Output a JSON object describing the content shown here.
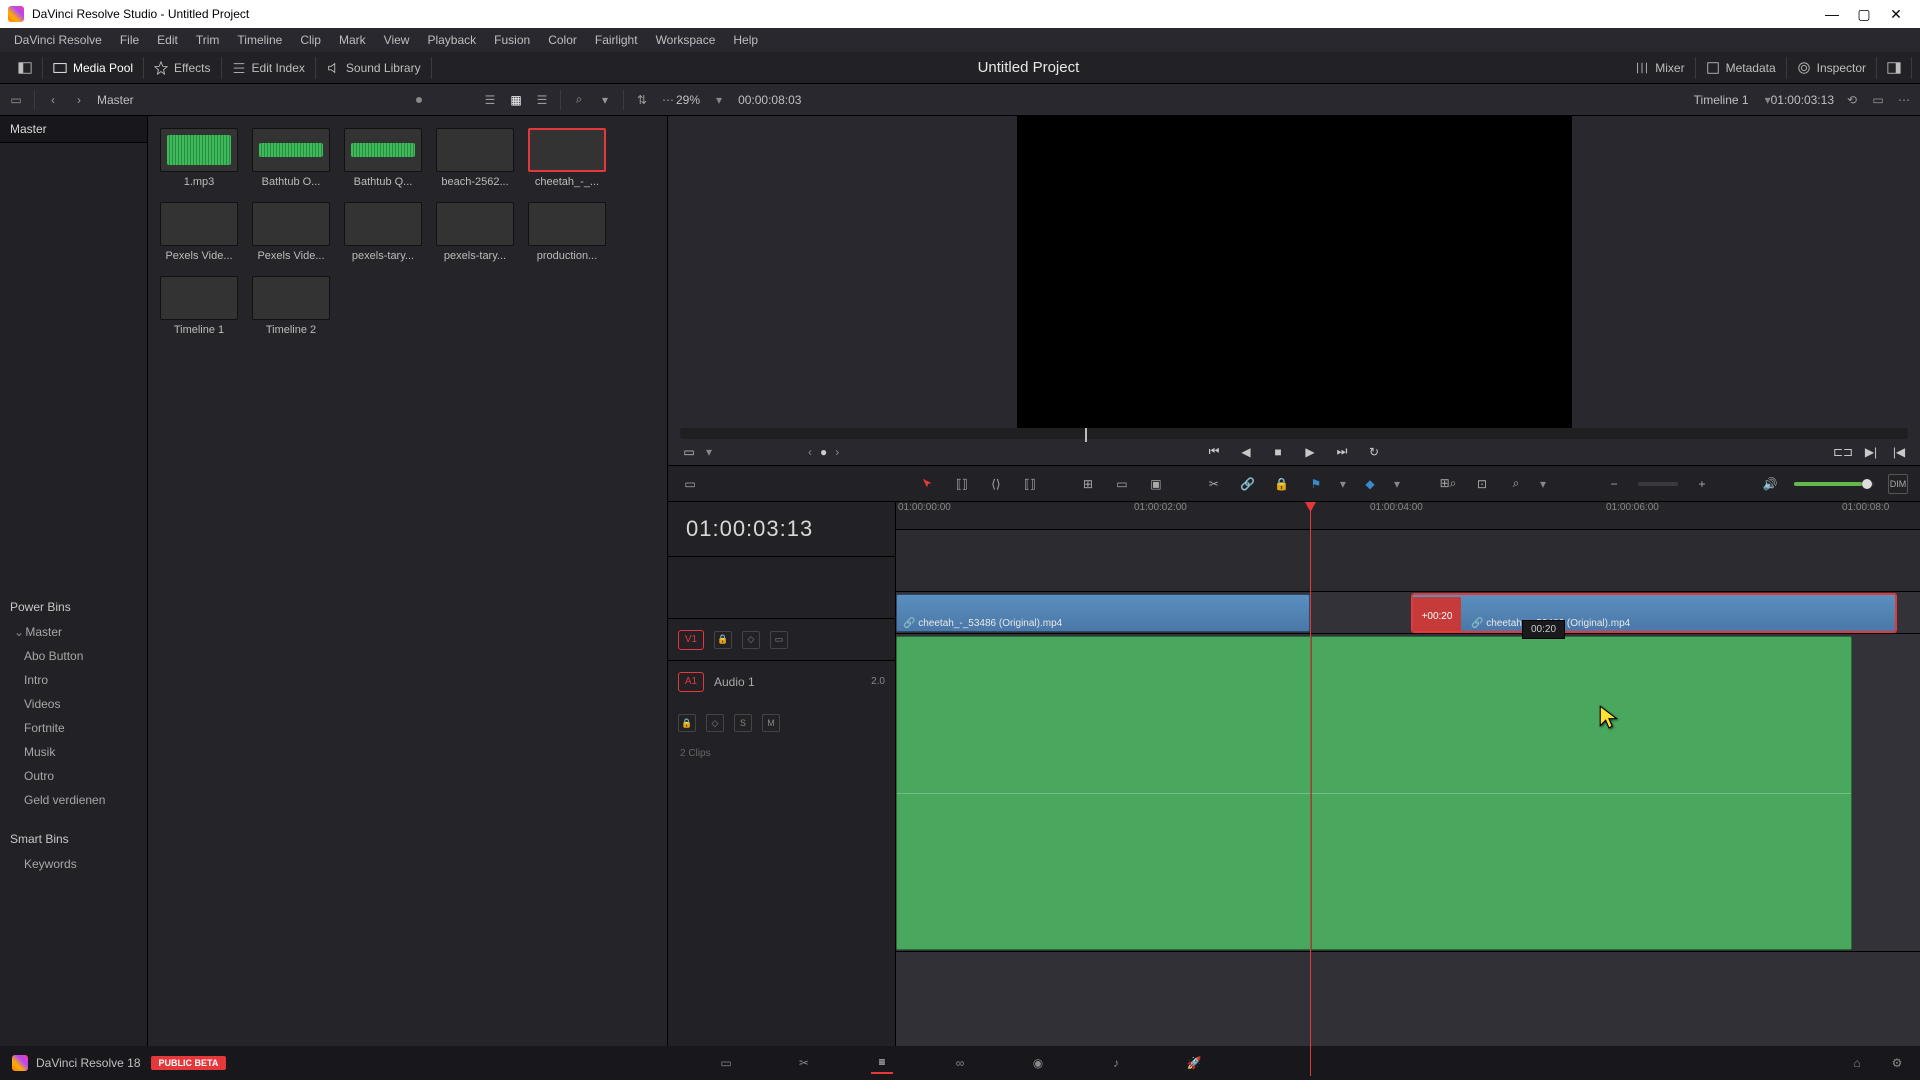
{
  "window": {
    "title": "DaVinci Resolve Studio - Untitled Project"
  },
  "menu": [
    "DaVinci Resolve",
    "File",
    "Edit",
    "Trim",
    "Timeline",
    "Clip",
    "Mark",
    "View",
    "Playback",
    "Fusion",
    "Color",
    "Fairlight",
    "Workspace",
    "Help"
  ],
  "toptool": {
    "left": [
      {
        "id": "media-pool",
        "label": "Media Pool",
        "active": true
      },
      {
        "id": "effects",
        "label": "Effects"
      },
      {
        "id": "edit-index",
        "label": "Edit Index"
      },
      {
        "id": "sound-library",
        "label": "Sound Library"
      }
    ],
    "title": "Untitled Project",
    "right": [
      {
        "id": "mixer",
        "label": "Mixer"
      },
      {
        "id": "metadata",
        "label": "Metadata"
      },
      {
        "id": "inspector",
        "label": "Inspector"
      }
    ]
  },
  "secbar": {
    "bin": "Master",
    "zoom": "29%",
    "src_tc": "00:00:08:03",
    "timeline": "Timeline 1",
    "rec_tc": "01:00:03:13"
  },
  "bins": {
    "root": "Master",
    "powerbins_title": "Power Bins",
    "powerbins": [
      "Master",
      "Abo Button",
      "Intro",
      "Videos",
      "Fortnite",
      "Musik",
      "Outro",
      "Geld verdienen"
    ],
    "smartbins_title": "Smart Bins",
    "smartbins": [
      "Keywords"
    ]
  },
  "clips": [
    {
      "name": "1.mp3",
      "type": "audio"
    },
    {
      "name": "Bathtub O...",
      "type": "audio-s"
    },
    {
      "name": "Bathtub Q...",
      "type": "audio-s"
    },
    {
      "name": "beach-2562...",
      "type": "beach"
    },
    {
      "name": "cheetah_-_...",
      "type": "grass",
      "selected": true
    },
    {
      "name": "Pexels Vide...",
      "type": "gray"
    },
    {
      "name": "Pexels Vide...",
      "type": "gray"
    },
    {
      "name": "pexels-tary...",
      "type": "grass"
    },
    {
      "name": "pexels-tary...",
      "type": "gray"
    },
    {
      "name": "production...",
      "type": "gray"
    },
    {
      "name": "Timeline 1",
      "type": "tl"
    },
    {
      "name": "Timeline 2",
      "type": "tl"
    }
  ],
  "timeline": {
    "tc": "01:00:03:13",
    "ruler": [
      "01:00:00:00",
      "01:00:02:00",
      "01:00:04:00",
      "01:00:06:00",
      "01:00:08:0"
    ],
    "v1": "V1",
    "a1": "A1",
    "a1_name": "Audio 1",
    "a1_ch": "2.0",
    "a1_clips": "2 Clips",
    "clip1": "cheetah_-_53486 (Original).mp4",
    "clip2": "cheetah_-_53486 (Original).mp4",
    "offset": "+00:20",
    "tooltip": "00:20"
  },
  "bottom": {
    "app": "DaVinci Resolve 18",
    "beta": "PUBLIC BETA"
  }
}
